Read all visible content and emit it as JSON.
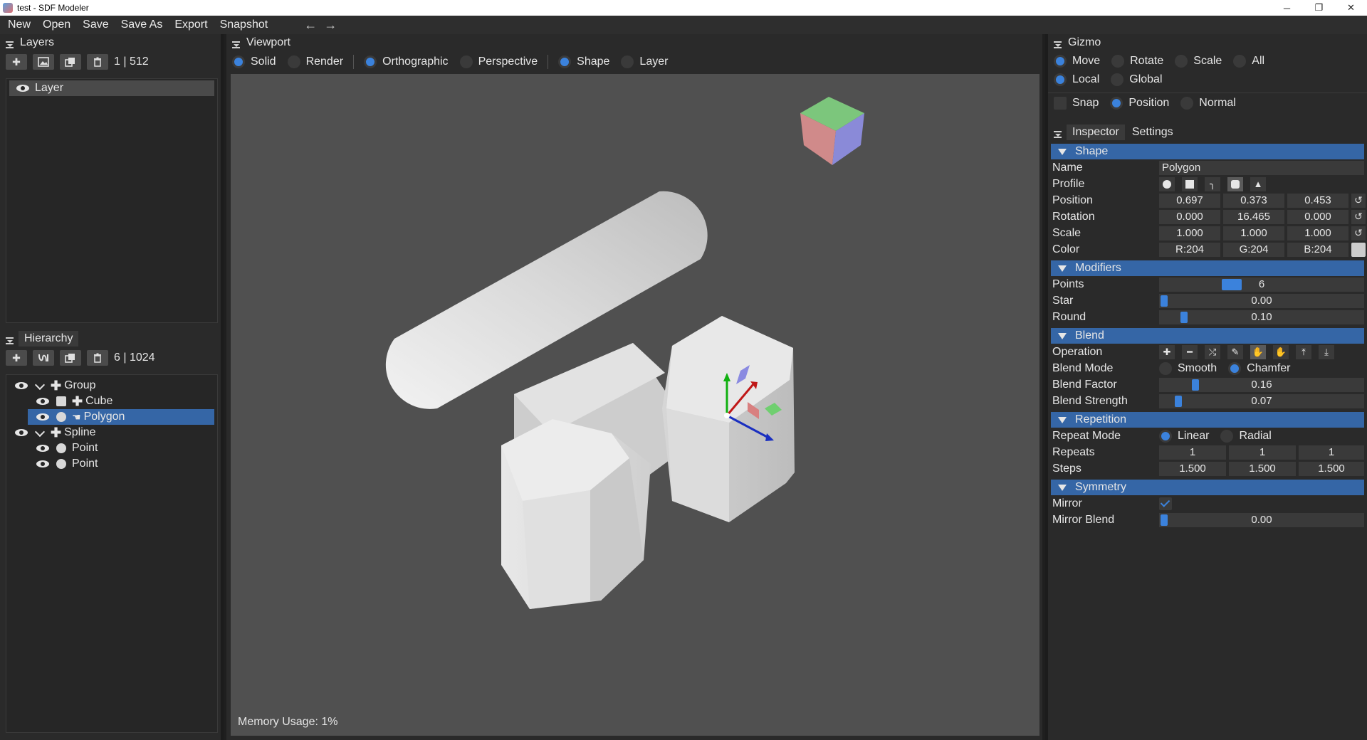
{
  "window": {
    "title": "test - SDF Modeler",
    "minimize": "─",
    "maximize": "❐",
    "close": "✕"
  },
  "menu": {
    "items": [
      "New",
      "Open",
      "Save",
      "Save As",
      "Export",
      "Snapshot"
    ],
    "back": "←",
    "forward": "→"
  },
  "layers": {
    "title": "Layers",
    "count": "1 | 512",
    "items": [
      {
        "label": "Layer"
      }
    ]
  },
  "hierarchy": {
    "title": "Hierarchy",
    "count": "6 | 1024",
    "items": [
      {
        "label": "Group",
        "kind": "group",
        "depth": 0
      },
      {
        "label": "Cube",
        "kind": "cube",
        "depth": 1
      },
      {
        "label": "Polygon",
        "kind": "polygon",
        "depth": 1,
        "selected": true
      },
      {
        "label": "Spline",
        "kind": "group",
        "depth": 0
      },
      {
        "label": "Point",
        "kind": "point",
        "depth": 1
      },
      {
        "label": "Point",
        "kind": "point",
        "depth": 1
      }
    ]
  },
  "viewport": {
    "title": "Viewport",
    "modes": {
      "solid": "Solid",
      "render": "Render",
      "orthographic": "Orthographic",
      "perspective": "Perspective",
      "shape": "Shape",
      "layer": "Layer"
    },
    "memory": "Memory Usage: 1%"
  },
  "gizmo": {
    "title": "Gizmo",
    "move": "Move",
    "rotate": "Rotate",
    "scale": "Scale",
    "all": "All",
    "local": "Local",
    "global": "Global",
    "snap": "Snap",
    "position": "Position",
    "normal": "Normal"
  },
  "inspector": {
    "tab_inspector": "Inspector",
    "tab_settings": "Settings",
    "shape": {
      "title": "Shape",
      "name_label": "Name",
      "name_value": "Polygon",
      "profile_label": "Profile",
      "position_label": "Position",
      "position": [
        "0.697",
        "0.373",
        "0.453"
      ],
      "rotation_label": "Rotation",
      "rotation": [
        "0.000",
        "16.465",
        "0.000"
      ],
      "scale_label": "Scale",
      "scale": [
        "1.000",
        "1.000",
        "1.000"
      ],
      "color_label": "Color",
      "color": [
        "R:204",
        "G:204",
        "B:204"
      ],
      "color_hex": "#cccccc"
    },
    "modifiers": {
      "title": "Modifiers",
      "points_label": "Points",
      "points_value": "6",
      "star_label": "Star",
      "star_value": "0.00",
      "round_label": "Round",
      "round_value": "0.10"
    },
    "blend": {
      "title": "Blend",
      "operation_label": "Operation",
      "mode_label": "Blend Mode",
      "smooth": "Smooth",
      "chamfer": "Chamfer",
      "factor_label": "Blend Factor",
      "factor_value": "0.16",
      "strength_label": "Blend Strength",
      "strength_value": "0.07"
    },
    "repetition": {
      "title": "Repetition",
      "mode_label": "Repeat Mode",
      "linear": "Linear",
      "radial": "Radial",
      "repeats_label": "Repeats",
      "repeats": [
        "1",
        "1",
        "1"
      ],
      "steps_label": "Steps",
      "steps": [
        "1.500",
        "1.500",
        "1.500"
      ]
    },
    "symmetry": {
      "title": "Symmetry",
      "mirror_label": "Mirror",
      "mirror_blend_label": "Mirror Blend",
      "mirror_blend_value": "0.00"
    }
  },
  "colors": {
    "accent": "#3b82dc",
    "selected": "#3566a6",
    "viewport_bg": "#505050"
  }
}
